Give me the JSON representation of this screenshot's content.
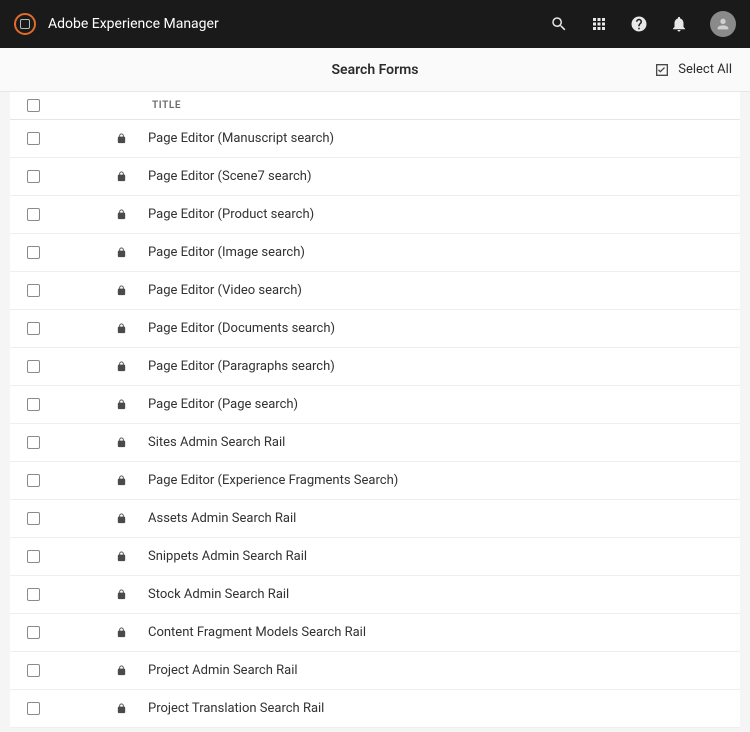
{
  "header": {
    "app_name": "Adobe Experience Manager"
  },
  "subbar": {
    "page_title": "Search Forms",
    "select_all": "Select All"
  },
  "columns": {
    "title": "Title"
  },
  "rows": [
    {
      "title": "Page Editor (Manuscript search)"
    },
    {
      "title": "Page Editor (Scene7 search)"
    },
    {
      "title": "Page Editor (Product search)"
    },
    {
      "title": "Page Editor (Image search)"
    },
    {
      "title": "Page Editor (Video search)"
    },
    {
      "title": "Page Editor (Documents search)"
    },
    {
      "title": "Page Editor (Paragraphs search)"
    },
    {
      "title": "Page Editor (Page search)"
    },
    {
      "title": "Sites Admin Search Rail"
    },
    {
      "title": "Page Editor (Experience Fragments Search)"
    },
    {
      "title": "Assets Admin Search Rail"
    },
    {
      "title": "Snippets Admin Search Rail"
    },
    {
      "title": "Stock Admin Search Rail"
    },
    {
      "title": "Content Fragment Models Search Rail"
    },
    {
      "title": "Project Admin Search Rail"
    },
    {
      "title": "Project Translation Search Rail"
    }
  ]
}
